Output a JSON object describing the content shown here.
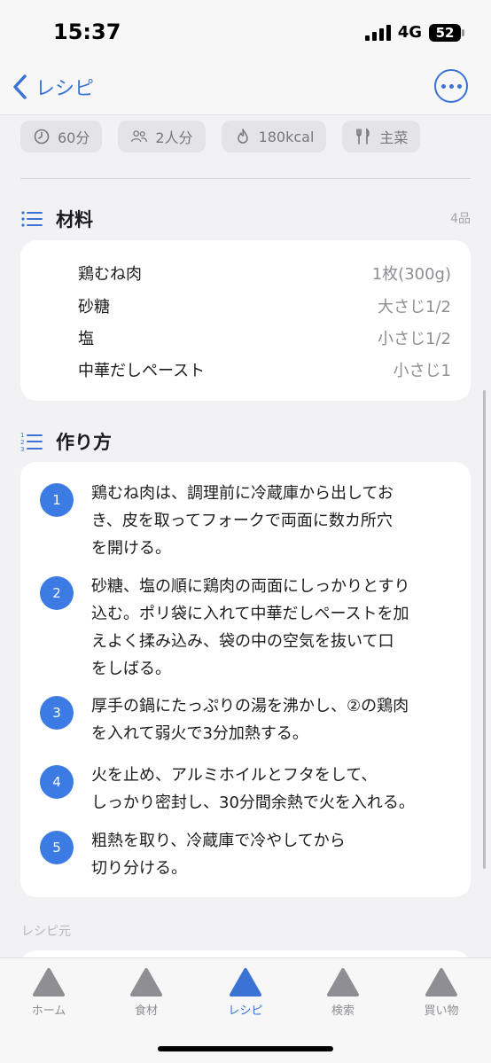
{
  "status": {
    "time": "15:37",
    "network": "4G",
    "battery": "52"
  },
  "nav": {
    "back_label": "レシピ"
  },
  "chips": [
    {
      "icon": "clock-icon",
      "label": "60分"
    },
    {
      "icon": "people-icon",
      "label": "2人分"
    },
    {
      "icon": "flame-icon",
      "label": "180kcal"
    },
    {
      "icon": "fork-knife-icon",
      "label": "主菜"
    }
  ],
  "ingredients": {
    "title": "材料",
    "count": "4品",
    "items": [
      {
        "name": "鶏むね肉",
        "qty": "1枚(300g)"
      },
      {
        "name": "砂糖",
        "qty": "大さじ1/2"
      },
      {
        "name": "塩",
        "qty": "小さじ1/2"
      },
      {
        "name": "中華だしペースト",
        "qty": "小さじ1"
      }
    ]
  },
  "steps": {
    "title": "作り方",
    "items": [
      {
        "num": "1",
        "line1": "鶏むね肉は、調理前に冷蔵庫から出してお",
        "line2": "き、皮を取ってフォークで両面に数カ所穴",
        "line3": "を開ける。",
        "line4": ""
      },
      {
        "num": "2",
        "line1": "砂糖、塩の順に鶏肉の両面にしっかりとすり",
        "line2": "込む。ポリ袋に入れて中華だしペーストを加",
        "line3": "えよく揉み込み、袋の中の空気を抜いて口",
        "line4": "をしばる。"
      },
      {
        "num": "3",
        "line1": "厚手の鍋にたっぷりの湯を沸かし、②の鶏肉",
        "line2": "を入れて弱火で3分加熱する。",
        "line3": "",
        "line4": ""
      },
      {
        "num": "4",
        "line1": "火を止め、アルミホイルとフタをして、",
        "line2": "しっかり密封し、30分間余熱で火を入れる。",
        "line3": "",
        "line4": ""
      },
      {
        "num": "5",
        "line1": "粗熱を取り、冷蔵庫で冷やしてから",
        "line2": "切り分ける。",
        "line3": "",
        "line4": ""
      }
    ]
  },
  "source": {
    "label": "レシピ元"
  },
  "tabs": [
    {
      "label": "ホーム",
      "active": false
    },
    {
      "label": "食材",
      "active": false
    },
    {
      "label": "レシピ",
      "active": true
    },
    {
      "label": "検索",
      "active": false
    },
    {
      "label": "買い物",
      "active": false
    }
  ],
  "colors": {
    "accent": "#3b73d4",
    "step_badge": "#3d7be4",
    "tab_icon_inactive": "#8e8e93"
  }
}
